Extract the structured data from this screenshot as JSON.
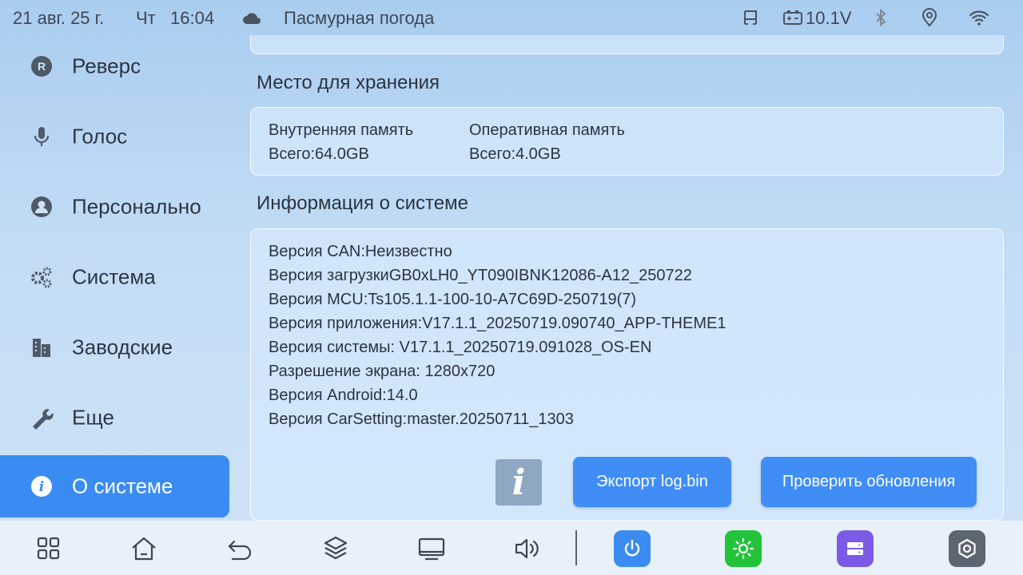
{
  "status_bar": {
    "date": "21 авг. 25 г.",
    "weekday": "Чт",
    "time": "16:04",
    "weather_icon": "cloud-icon",
    "weather": "Пасмурная погода",
    "battery_voltage": "10.1V"
  },
  "sidebar": {
    "items": [
      {
        "label": "Реверс",
        "icon": "reverse-r-icon"
      },
      {
        "label": "Голос",
        "icon": "microphone-icon"
      },
      {
        "label": "Персонально",
        "icon": "person-icon"
      },
      {
        "label": "Система",
        "icon": "gears-icon"
      },
      {
        "label": "Заводские",
        "icon": "factory-icon"
      },
      {
        "label": "Еще",
        "icon": "wrench-icon"
      },
      {
        "label": "О системе",
        "icon": "info-icon",
        "active": true
      }
    ]
  },
  "main": {
    "storage": {
      "title": "Место для хранения",
      "internal_label": "Внутренняя память",
      "internal_value": "Всего:64.0GB",
      "ram_label": "Оперативная память",
      "ram_value": "Всего:4.0GB"
    },
    "system_info": {
      "title": "Информация о системе",
      "lines": [
        "Версия CAN:Неизвестно",
        "Версия загрузкиGB0xLH0_YT090IBNK12086-A12_250722",
        "Версия MCU:Ts105.1.1-100-10-A7C69D-250719(7)",
        "Версия приложения:V17.1.1_20250719.090740_APP-THEME1",
        "Версия системы: V17.1.1_20250719.091028_OS-EN",
        "Разрешение экрана: 1280x720",
        "Версия Android:14.0",
        "Версия CarSetting:master.20250711_1303"
      ],
      "info_tile_glyph": "i",
      "export_button": "Экспорт log.bin",
      "update_button": "Проверить обновления"
    }
  },
  "dock": {
    "items": [
      "apps-grid-icon",
      "home-icon",
      "back-icon",
      "layers-icon",
      "monitor-icon",
      "volume-icon",
      "power-icon",
      "brightness-icon",
      "storage-icon",
      "settings-hex-icon"
    ]
  },
  "colors": {
    "accent": "#3a8cf2",
    "power_tile": "#3a8cf2",
    "brightness_tile": "#22c23b",
    "storage_tile": "#7b5be6",
    "settings_tile": "#5c6670"
  }
}
